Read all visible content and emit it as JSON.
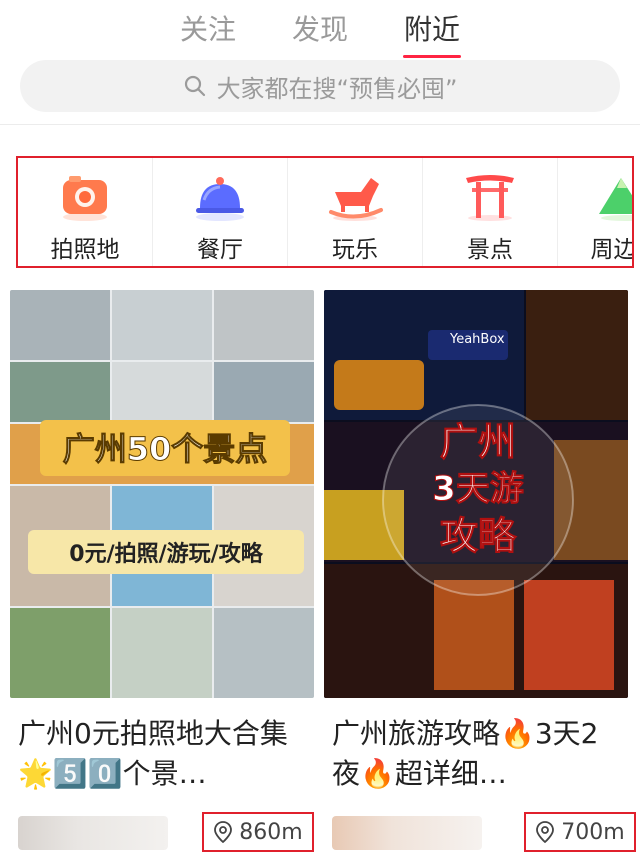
{
  "tabs": {
    "follow": "关注",
    "discover": "发现",
    "nearby": "附近"
  },
  "search": {
    "placeholder": "大家都在搜“预售必囤”"
  },
  "categories": [
    {
      "label": "拍照地",
      "icon": "camera-icon"
    },
    {
      "label": "餐厅",
      "icon": "dish-cloche-icon"
    },
    {
      "label": "玩乐",
      "icon": "rocking-horse-icon"
    },
    {
      "label": "景点",
      "icon": "torii-gate-icon"
    },
    {
      "label": "周边游",
      "icon": "mountain-icon"
    }
  ],
  "posts": [
    {
      "cover_text_1": "广州50个景点",
      "cover_text_2": "0元/拍照/游玩/攻略",
      "title": "广州0元拍照地大合集🌟5️⃣0️⃣个景…",
      "distance": "860m"
    },
    {
      "cover_text_1": "广州",
      "cover_text_2": "3天游",
      "cover_text_3": "攻略",
      "cover_sign": "YeahBox",
      "title": "广州旅游攻略🔥3天2夜🔥超详细…",
      "distance": "700m"
    }
  ],
  "colors": {
    "accent": "#ff2442",
    "highlight_box": "#e0202c"
  }
}
